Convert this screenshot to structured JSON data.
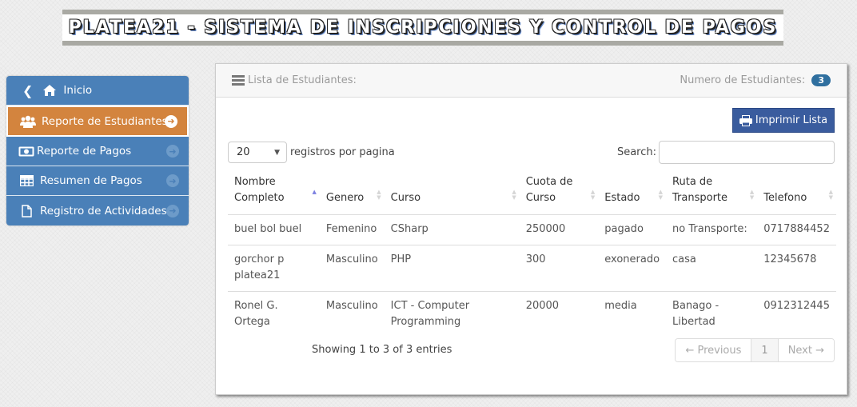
{
  "banner": {
    "title": "PLATEA21 - Sistema de Inscripciones y Control de Pagos"
  },
  "sidebar": {
    "items": [
      {
        "label": "Inicio",
        "icon": "home-icon",
        "active": false
      },
      {
        "label": "Reporte de Estudiantes",
        "icon": "users-icon",
        "active": true
      },
      {
        "label": "Reporte de Pagos",
        "icon": "money-icon",
        "active": false
      },
      {
        "label": "Resumen de Pagos",
        "icon": "table-icon",
        "active": false
      },
      {
        "label": "Registro de Actividades",
        "icon": "file-icon",
        "active": false
      }
    ]
  },
  "panel": {
    "title": "Lista de Estudiantes:",
    "count_label": "Numero de Estudiantes:",
    "count": "3",
    "print_label": "Imprimir Lista",
    "length_value": "20",
    "length_suffix": "registros por pagina",
    "search_label": "Search:",
    "search_value": "",
    "info": "Showing 1 to 3 of 3 entries",
    "pager": {
      "prev": "← Previous",
      "page": "1",
      "next": "Next →"
    }
  },
  "table": {
    "columns": [
      {
        "label": "Nombre Completo",
        "sort": "asc"
      },
      {
        "label": "Genero",
        "sort": "none"
      },
      {
        "label": "Curso",
        "sort": "none"
      },
      {
        "label": "Cuota de Curso",
        "sort": "none"
      },
      {
        "label": "Estado",
        "sort": "none"
      },
      {
        "label": "Ruta de Transporte",
        "sort": "none"
      },
      {
        "label": "Telefono",
        "sort": "none"
      }
    ],
    "rows": [
      [
        "buel bol buel",
        "Femenino",
        "CSharp",
        "250000",
        "pagado",
        "no Transporte:",
        "0717884452"
      ],
      [
        "gorchor p platea21",
        "Masculino",
        "PHP",
        "300",
        "exonerado",
        "casa",
        "12345678"
      ],
      [
        "Ronel G. Ortega",
        "Masculino",
        "ICT - Computer Programming",
        "20000",
        "media",
        "Banago - Libertad",
        "0912312445"
      ]
    ]
  },
  "colors": {
    "sidebar": "#4a80b8",
    "active": "#d3843e",
    "print_button": "#3a5c9e",
    "badge": "#2f6f9f"
  }
}
